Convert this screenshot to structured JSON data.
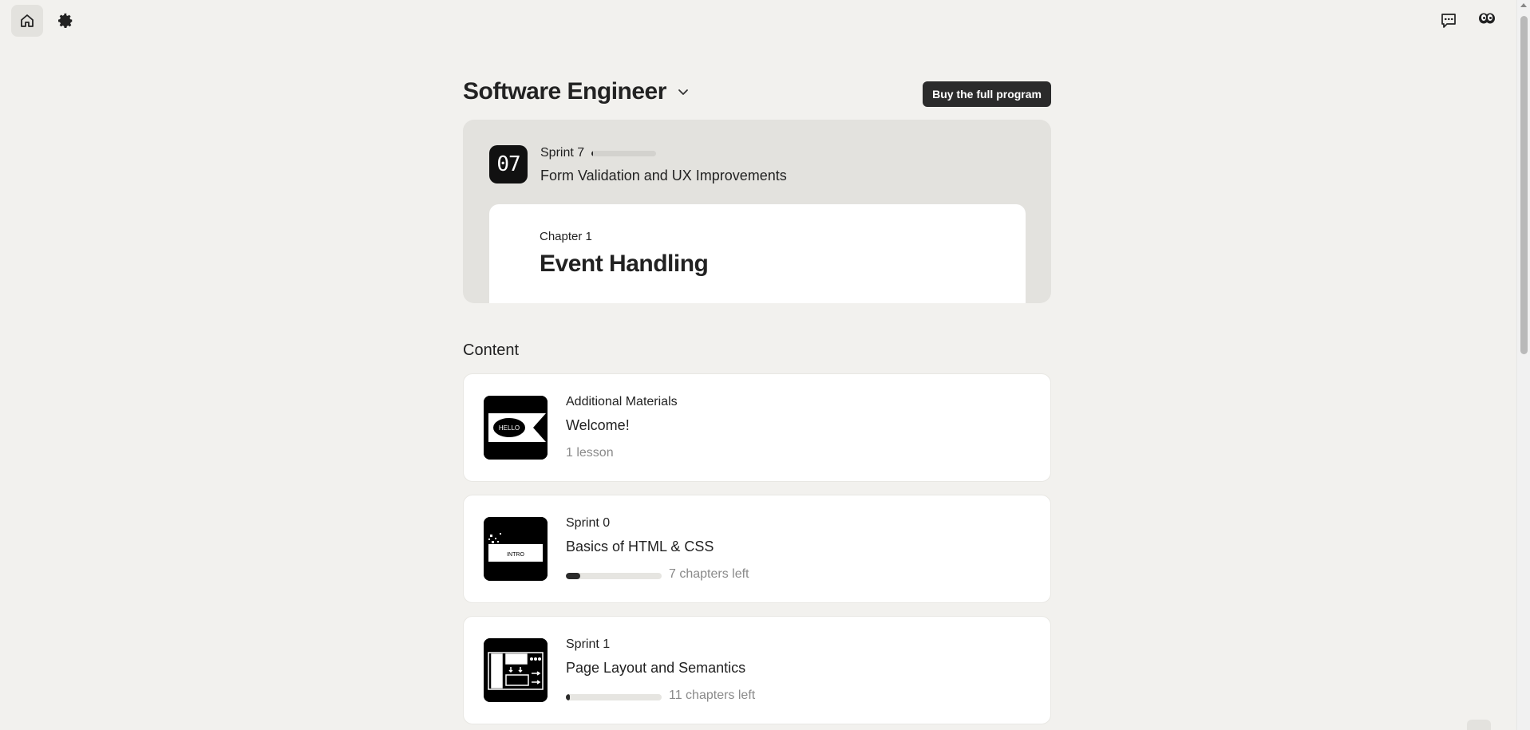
{
  "topbar": {
    "home_icon": "home-icon",
    "settings_icon": "gear-icon",
    "chat_icon": "chat-icon",
    "profile_icon": "avatar-icon"
  },
  "program": {
    "title": "Software Engineer",
    "buy_label": "Buy the full program"
  },
  "current": {
    "sprint_number": "07",
    "sprint_label": "Sprint 7",
    "sprint_progress": 0.03,
    "sprint_title": "Form Validation and UX Improvements",
    "chapter_label": "Chapter 1",
    "chapter_title": "Event Handling"
  },
  "content": {
    "heading": "Content",
    "items": [
      {
        "kicker": "Additional Materials",
        "title": "Welcome!",
        "meta": "1 lesson",
        "thumb_text": "HELLO"
      },
      {
        "kicker": "Sprint 0",
        "title": "Basics of HTML & CSS",
        "meta": "7 chapters left",
        "progress": 0.15,
        "thumb_text": "INTRO"
      },
      {
        "kicker": "Sprint 1",
        "title": "Page Layout and Semantics",
        "meta": "11 chapters left",
        "progress": 0.04
      }
    ]
  },
  "colors": {
    "background": "#f2f1ee",
    "accent": "#2b2b2b",
    "card": "#ffffff",
    "muted": "#8a8a8a"
  }
}
